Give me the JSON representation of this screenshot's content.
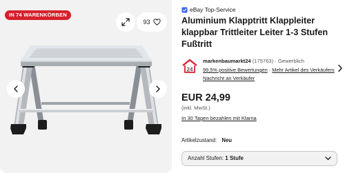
{
  "gallery": {
    "badge": "IN 74 WARENKÖRBEN",
    "watchers": "93",
    "icons": {
      "expand": "expand-icon",
      "watch": "heart-icon",
      "prev": "chevron-left-icon",
      "next": "chevron-right-icon"
    }
  },
  "listing": {
    "top_service": "eBay Top-Service",
    "title": "Aluminium Klapptritt Klappleiter klappbar Trittleiter Leiter 1-3 Stufen Fußtritt"
  },
  "seller": {
    "name": "markenbaumarkt24",
    "count": "(175763)",
    "type": "Gewerblich",
    "positive": "99,5% positive Bewertungen",
    "more_items": "Mehr Artikel des Verkäufers",
    "contact": "Nachricht an Verkäufer",
    "separator": "·"
  },
  "pricing": {
    "price": "EUR 24,99",
    "vat": "(inkl. MwSt.)",
    "klarna": "In 30 Tagen bezahlen mit Klarna"
  },
  "condition": {
    "label": "Artikelzustand:",
    "value": "Neu"
  },
  "quantity": {
    "label": "Anzahl Stufen:",
    "value": "1 Stufe"
  },
  "colors": {
    "badge": "#d6202c",
    "top_service_blue": "#3665f3",
    "text": "#191919",
    "gallery_bg": "#f2f2f2"
  }
}
